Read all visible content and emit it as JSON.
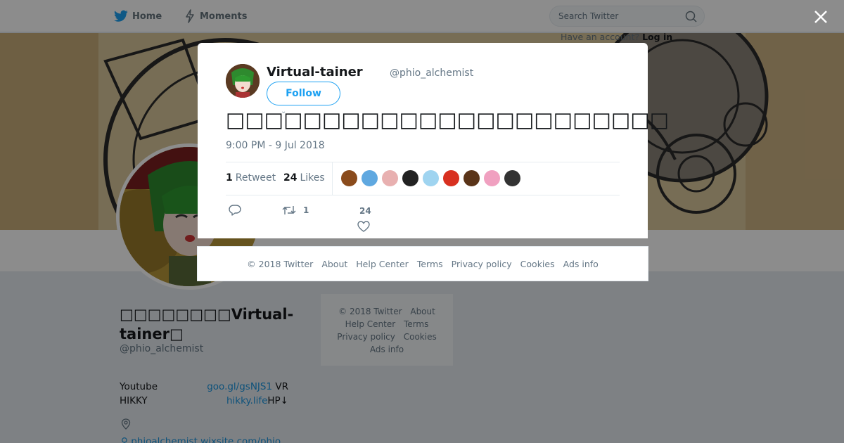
{
  "nav": {
    "home_label": "Home",
    "moments_label": "Moments",
    "search_placeholder": "Search Twitter",
    "have_account_text": "Have an account?",
    "login_label": "Log in"
  },
  "profile": {
    "display_name": "□□□□□□□□Virtual-tainer□",
    "handle": "@phio_alchemist",
    "bio_line1_left": "Youtube",
    "bio_link1": "goo.gl/gsNJS1",
    "bio_line1_right": "VR",
    "bio_line2_left": "HIKKY",
    "bio_link2": "hikky.life",
    "bio_line2_right": "HP↓",
    "website": "phioalchemist.wixsite.com/phio"
  },
  "side_footer": {
    "copyright": "© 2018 Twitter",
    "about": "About",
    "help_center": "Help Center",
    "terms": "Terms",
    "privacy": "Privacy policy",
    "cookies": "Cookies",
    "ads_info": "Ads info"
  },
  "tweet": {
    "author_name": "Virtual-tainer",
    "author_handle": "@phio_alchemist",
    "follow_label": "Follow",
    "text": "□□□□□□□□□□□□□□□□□□□□□□□",
    "timestamp": "9:00 PM - 9 Jul 2018",
    "retweet_count": "1",
    "retweet_label": "Retweet",
    "like_count": "24",
    "like_label": "Likes",
    "action_retweet_count": "1",
    "action_like_count": "24",
    "liker_colors": [
      "#8a4b1c",
      "#5fa8e0",
      "#e8b0b0",
      "#222222",
      "#9fd4f0",
      "#d83020",
      "#5a3418",
      "#f0a0c0",
      "#333333"
    ]
  },
  "modal_footer": {
    "copyright": "© 2018 Twitter",
    "about": "About",
    "help_center": "Help Center",
    "terms": "Terms",
    "privacy": "Privacy policy",
    "cookies": "Cookies",
    "ads_info": "Ads info"
  },
  "colors": {
    "brand_blue": "#1da1f2",
    "link_blue": "#1b95e0"
  }
}
